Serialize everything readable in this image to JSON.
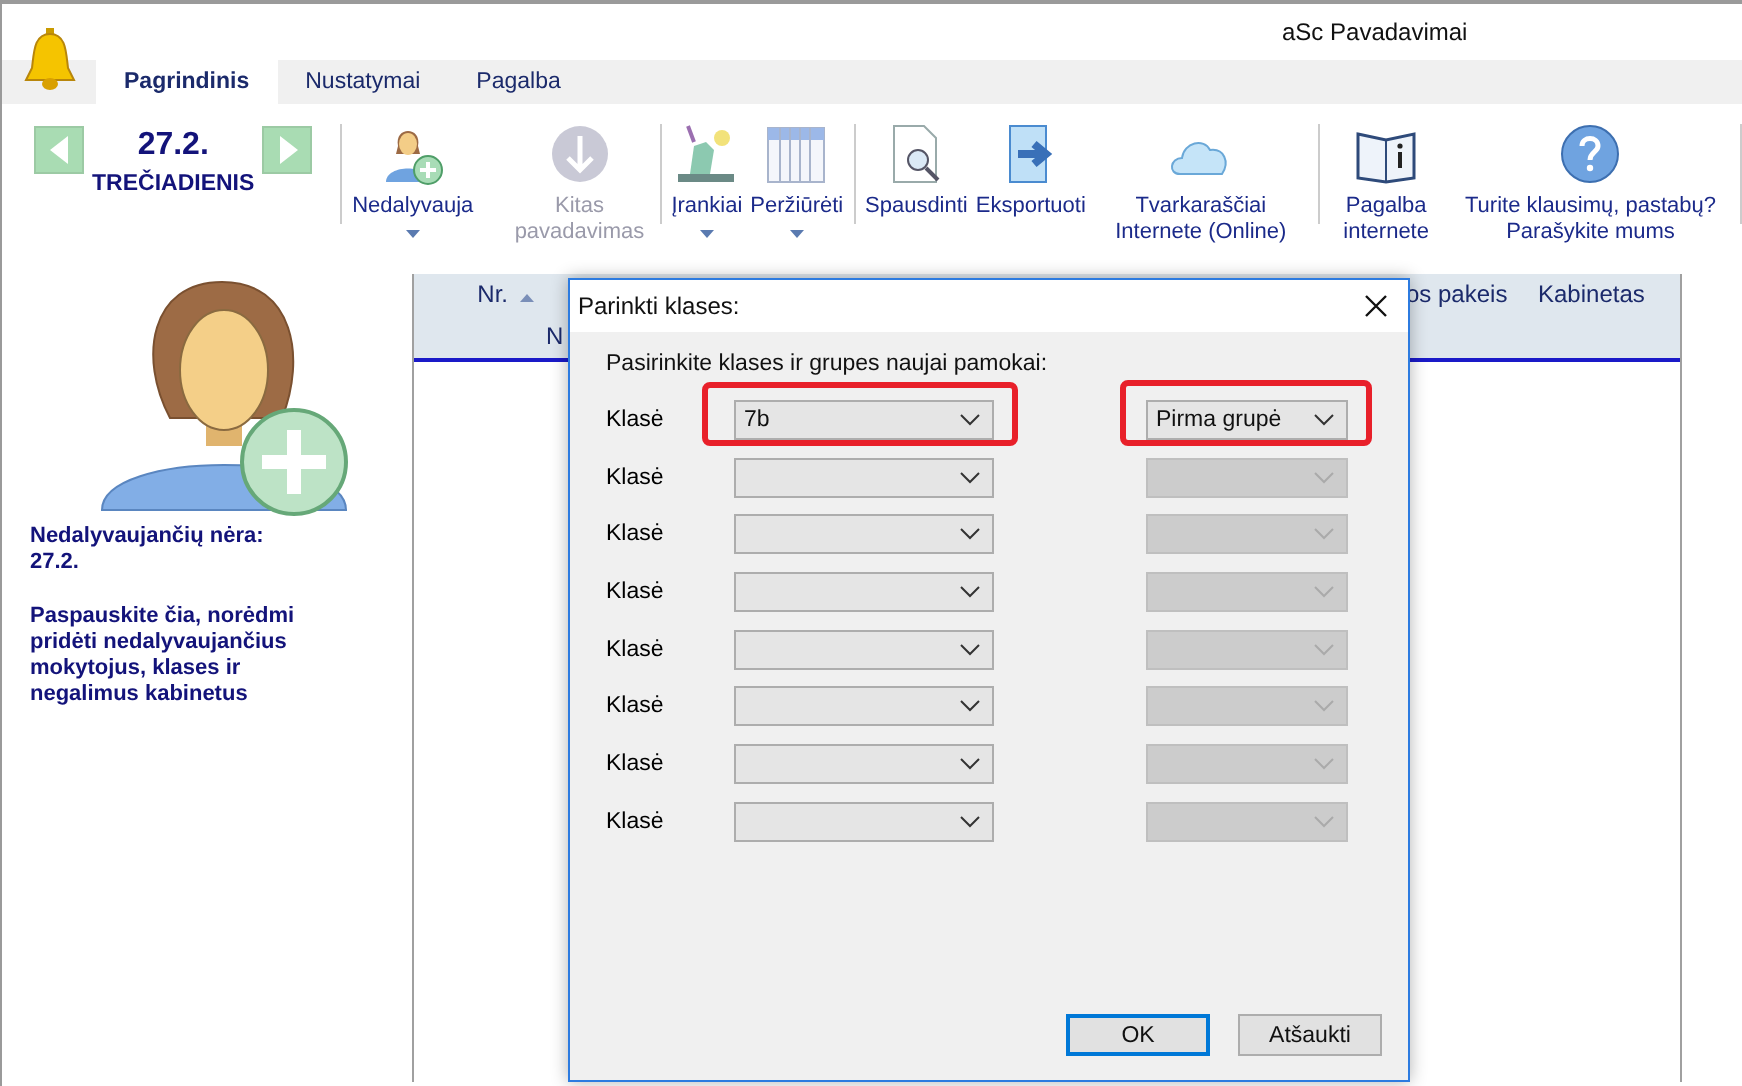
{
  "window": {
    "title": "aSc Pavadavimai"
  },
  "tabs": [
    {
      "label": "Pagrindinis",
      "selected": true
    },
    {
      "label": "Nustatymai",
      "selected": false
    },
    {
      "label": "Pagalba",
      "selected": false
    }
  ],
  "date_nav": {
    "date": "27.2.",
    "day": "TREČIADIENIS"
  },
  "ribbon_groups": [
    [
      {
        "label": "Nedalyvauja",
        "disabled": false,
        "dropdown": true
      },
      {
        "label": "Kitas pavadavimas",
        "disabled": true,
        "dropdown": false
      }
    ],
    [
      {
        "label": "Įrankiai",
        "disabled": false,
        "dropdown": true
      },
      {
        "label": "Peržiūrėti",
        "disabled": false,
        "dropdown": true
      }
    ],
    [
      {
        "label": "Spausdinti",
        "disabled": false,
        "dropdown": false
      },
      {
        "label": "Eksportuoti",
        "disabled": false,
        "dropdown": false
      },
      {
        "label": "Tvarkaraščiai Internete (Online)",
        "disabled": false,
        "dropdown": false
      }
    ],
    [
      {
        "label": "Pagalba internete",
        "disabled": false,
        "dropdown": false
      },
      {
        "label": "Turite klausimų, pastabų? Parašykite mums",
        "disabled": false,
        "dropdown": false
      }
    ]
  ],
  "left_panel": {
    "status": "Nedalyvaujančių nėra: 27.2.",
    "hint": "Paspauskite čia, norėdmi pridėti nedalyvaujančius mokytojus, klases ir negalimus kabinetus"
  },
  "table": {
    "columns": [
      {
        "label": "Nr.",
        "sorted": true
      },
      {
        "label": "N",
        "sorted": false
      },
      {
        "label": "os pakeis",
        "sorted": false
      },
      {
        "label": "Kabinetas",
        "sorted": false
      }
    ]
  },
  "dialog": {
    "title": "Parinkti klases:",
    "prompt": "Pasirinkite klases ir grupes naujai pamokai:",
    "rows": [
      {
        "label": "Klasė",
        "class_value": "7b",
        "group_value": "Pirma grupė",
        "group_disabled": false,
        "highlighted": true
      },
      {
        "label": "Klasė",
        "group_disabled": true,
        "highlighted": false
      },
      {
        "label": "Klasė",
        "group_disabled": true,
        "highlighted": false
      },
      {
        "label": "Klasė",
        "group_disabled": true,
        "highlighted": false
      },
      {
        "label": "Klasė",
        "group_disabled": true,
        "highlighted": false
      },
      {
        "label": "Klasė",
        "group_disabled": true,
        "highlighted": false
      },
      {
        "label": "Klasė",
        "group_disabled": true,
        "highlighted": false
      },
      {
        "label": "Klasė",
        "group_disabled": true,
        "highlighted": false
      }
    ],
    "buttons": [
      {
        "label": "OK",
        "default": true
      },
      {
        "label": "Atšaukti",
        "default": false
      }
    ]
  }
}
